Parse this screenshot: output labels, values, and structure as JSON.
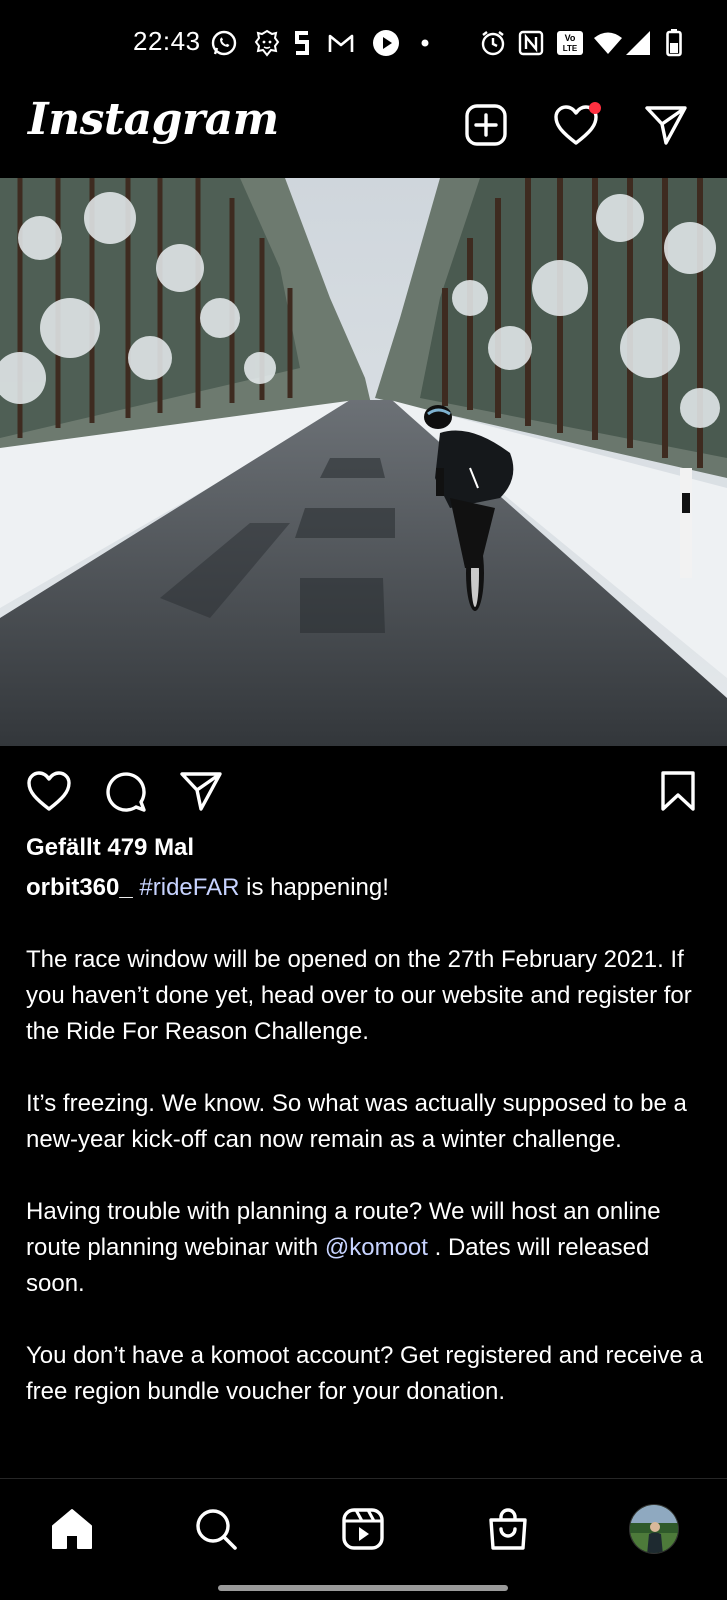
{
  "status_bar": {
    "time": "22:43",
    "icons": [
      "whatsapp-icon",
      "lion-app-icon",
      "s-app-icon",
      "gmail-icon",
      "play-icon",
      "dot-icon",
      "alarm-icon",
      "nfc-icon",
      "volte-icon",
      "wifi-icon",
      "signal-icon",
      "battery-icon"
    ],
    "volte_label": "Vo LTE",
    "nfc_label": "N"
  },
  "app_bar": {
    "logo": "Instagram",
    "icons": [
      "add-post-icon",
      "heart-icon",
      "direct-message-icon"
    ],
    "notification_dot_color": "#ff3040"
  },
  "post": {
    "image_description_icon": "winter-road-cyclist-photo",
    "likes": "Gefällt 479 Mal",
    "username": "orbit360_",
    "hashtag": "#rideFAR",
    "headline_rest": " is happening!",
    "paragraph1": "The race window will be opened on the 27th February 2021. If you haven’t done yet, head over to our website and register for the Ride For Reason Challenge.",
    "paragraph2": "It’s freezing. We know. So what was actually supposed to be a new-year kick-off can now remain as a winter challenge.",
    "paragraph3_before": "Having trouble with planning a route? We will host an online route planning webinar with ",
    "mention": "@komoot",
    "paragraph3_after": " . Dates will released soon.",
    "paragraph4": "You don’t have a komoot account? Get registered and receive a free region bundle voucher for your donation.",
    "action_icons": [
      "like-icon",
      "comment-icon",
      "share-icon",
      "bookmark-icon"
    ]
  },
  "bottom_nav": {
    "items": [
      "home-icon",
      "search-icon",
      "reels-icon",
      "shop-icon",
      "profile-avatar"
    ]
  },
  "colors": {
    "background": "#000000",
    "text": "#ffffff",
    "link": "#c7d3ff",
    "notification": "#ff3040"
  }
}
